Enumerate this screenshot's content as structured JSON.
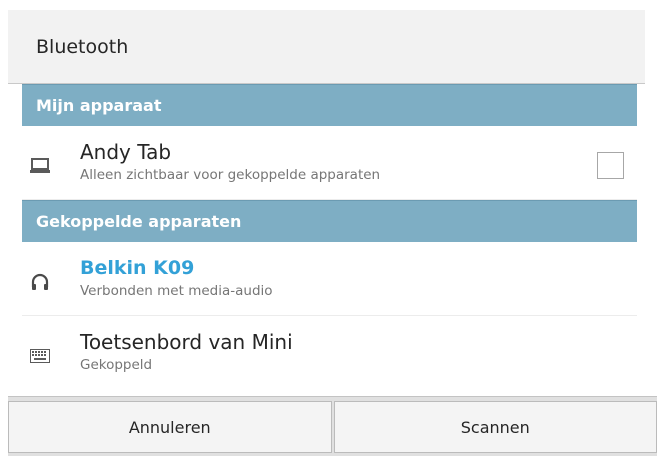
{
  "header": {
    "title": "Bluetooth"
  },
  "sections": [
    {
      "label": "Mijn apparaat"
    },
    {
      "label": "Gekoppelde apparaten"
    }
  ],
  "my_device": {
    "name": "Andy Tab",
    "subtitle": "Alleen zichtbaar voor gekoppelde apparaten",
    "icon": "laptop-icon",
    "visible_checked": false
  },
  "paired_devices": [
    {
      "name": "Belkin K09",
      "subtitle": "Verbonden met media-audio",
      "icon": "headphones-icon",
      "connected": true
    },
    {
      "name": "Toetsenbord van Mini",
      "subtitle": "Gekoppeld",
      "icon": "keyboard-icon",
      "connected": false
    }
  ],
  "buttons": {
    "cancel": "Annuleren",
    "scan": "Scannen"
  },
  "colors": {
    "section_bg": "#7eaec4",
    "connected_text": "#33a1d7"
  }
}
